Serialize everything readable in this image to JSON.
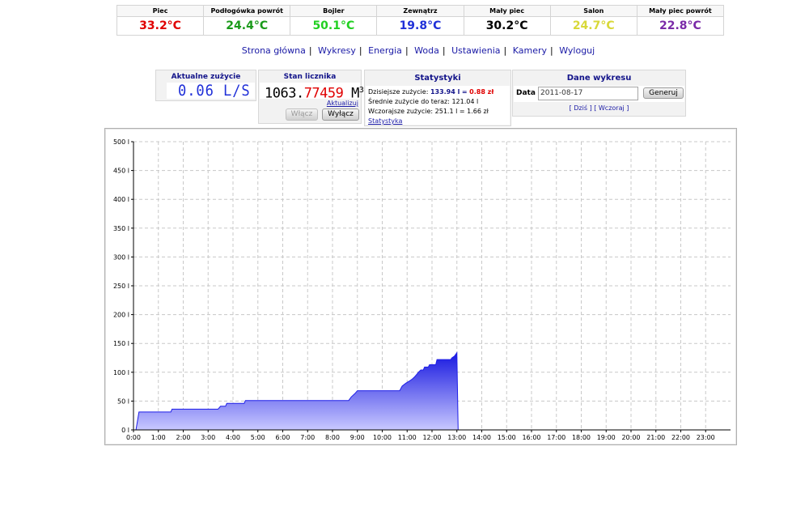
{
  "temperatures": [
    {
      "label": "Piec",
      "value": "33.2°C",
      "color": "#e00000"
    },
    {
      "label": "Podłogówka powrót",
      "value": "24.4°C",
      "color": "#1a9a1a"
    },
    {
      "label": "Bojler",
      "value": "50.1°C",
      "color": "#22d022"
    },
    {
      "label": "Zewnątrz",
      "value": "19.8°C",
      "color": "#2030d8"
    },
    {
      "label": "Mały piec",
      "value": "30.2°C",
      "color": "#000000"
    },
    {
      "label": "Salon",
      "value": "24.7°C",
      "color": "#d8d838"
    },
    {
      "label": "Mały piec powrót",
      "value": "22.8°C",
      "color": "#7a2aa8"
    }
  ],
  "nav": [
    "Strona główna",
    "Wykresy",
    "Energia",
    "Woda",
    "Ustawienia",
    "Kamery",
    "Wyloguj"
  ],
  "current": {
    "title": "Aktualne zużycie",
    "value": "0.06 L/S"
  },
  "meter": {
    "title": "Stan licznika",
    "value_black": "1063.",
    "value_red": "77459",
    "unit": "M",
    "unit_sup": "3",
    "refresh": "Aktualizuj",
    "on_label": "Włącz",
    "off_label": "Wyłącz"
  },
  "stats": {
    "title": "Statystyki",
    "today_label": "Dzisiejsze zużycie:",
    "today_value": "133.94 l",
    "today_eq": "=",
    "today_cost": "0.88 zł",
    "avg": "Średnie zużycie do teraz: 121.04 l",
    "yesterday": "Wczorajsze zużycie: 251.1 l = 1.66 zł",
    "link": "Statystyka"
  },
  "chart_panel": {
    "title": "Dane wykresu",
    "date_label": "Data",
    "date_value": "2011-08-17",
    "generate": "Generuj",
    "today_link": "[ Dziś ]",
    "yesterday_link": "[ Wczoraj ]"
  },
  "chart_data": {
    "type": "area",
    "color": "#1e1ee8",
    "xlabel": "",
    "ylabel": "",
    "xlim": [
      0,
      24
    ],
    "ylim": [
      0,
      500
    ],
    "x_ticks": [
      "0:00",
      "1:00",
      "2:00",
      "3:00",
      "4:00",
      "5:00",
      "6:00",
      "7:00",
      "8:00",
      "9:00",
      "10:00",
      "11:00",
      "12:00",
      "13:00",
      "14:00",
      "15:00",
      "16:00",
      "17:00",
      "18:00",
      "19:00",
      "20:00",
      "21:00",
      "22:00",
      "23:00"
    ],
    "y_ticks": [
      "0 l",
      "50 l",
      "100 l",
      "150 l",
      "200 l",
      "250 l",
      "300 l",
      "350 l",
      "400 l",
      "450 l",
      "500 l"
    ],
    "grid": true,
    "series": [
      {
        "points": [
          [
            0.1,
            0
          ],
          [
            0.22,
            31
          ],
          [
            1.5,
            31
          ],
          [
            1.55,
            36
          ],
          [
            3.4,
            36
          ],
          [
            3.5,
            41
          ],
          [
            3.7,
            41
          ],
          [
            3.75,
            46
          ],
          [
            4.45,
            46
          ],
          [
            4.5,
            51
          ],
          [
            8.65,
            51
          ],
          [
            8.75,
            57
          ],
          [
            8.9,
            63
          ],
          [
            9.0,
            68
          ],
          [
            10.7,
            68
          ],
          [
            10.8,
            76
          ],
          [
            10.95,
            81
          ],
          [
            11.1,
            85
          ],
          [
            11.2,
            88
          ],
          [
            11.3,
            92
          ],
          [
            11.4,
            97
          ],
          [
            11.45,
            100
          ],
          [
            11.55,
            104
          ],
          [
            11.65,
            104
          ],
          [
            11.7,
            109
          ],
          [
            11.85,
            109
          ],
          [
            11.9,
            113
          ],
          [
            12.15,
            113
          ],
          [
            12.2,
            122
          ],
          [
            12.75,
            122
          ],
          [
            12.8,
            125
          ],
          [
            12.9,
            128
          ],
          [
            13.0,
            133.94
          ],
          [
            13.05,
            0
          ]
        ]
      }
    ]
  }
}
